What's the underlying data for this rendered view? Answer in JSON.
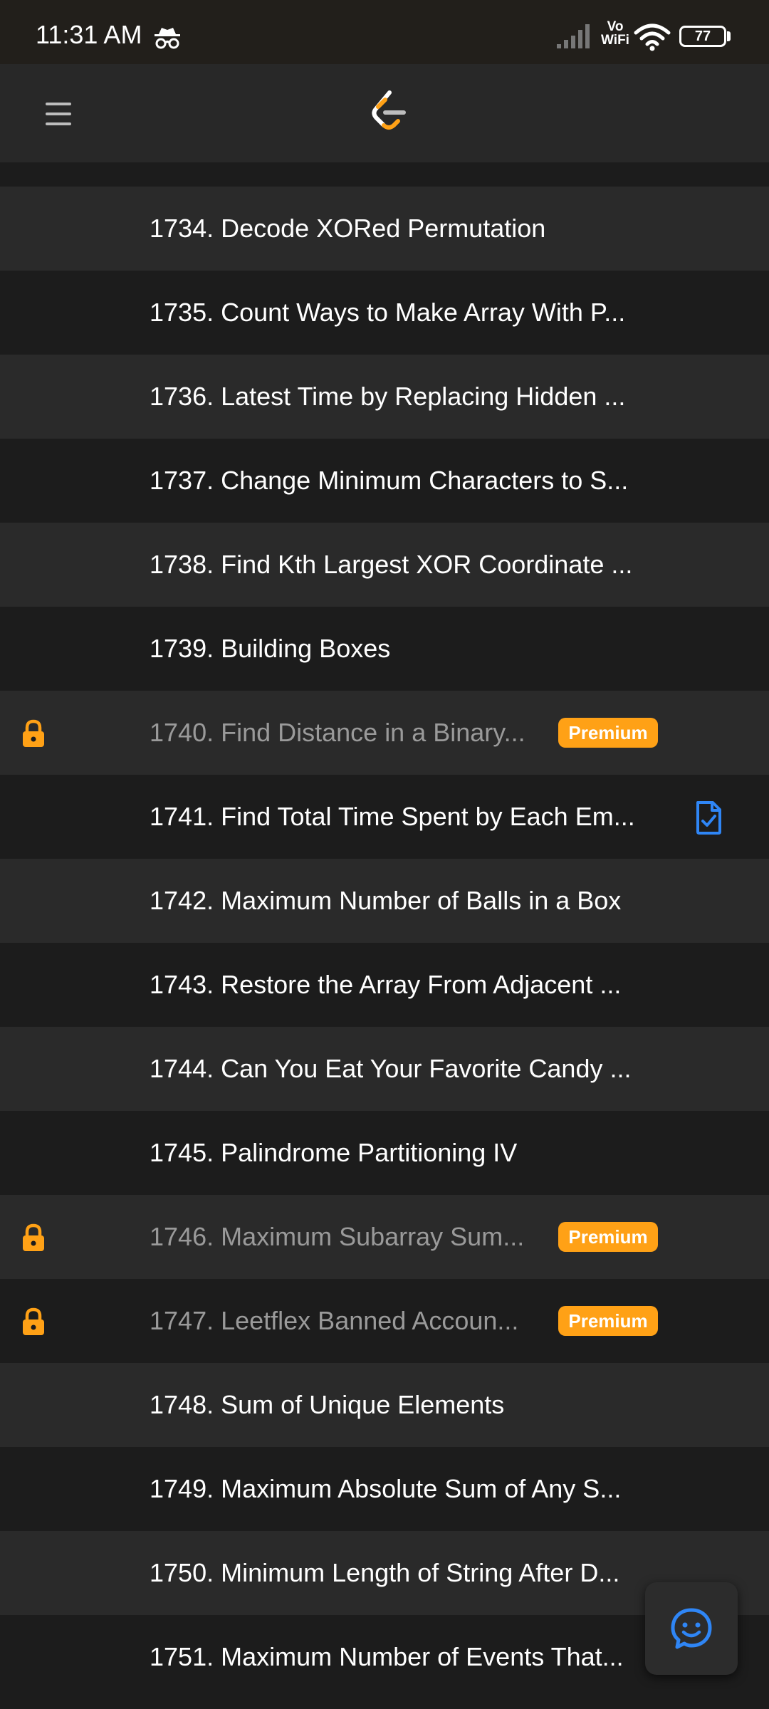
{
  "status_bar": {
    "time": "11:31 AM",
    "vowifi_line1": "Vo",
    "vowifi_line2": "WiFi",
    "battery": "77",
    "icons": [
      "incognito-icon",
      "signal-icon",
      "wifi-icon",
      "battery-icon"
    ]
  },
  "app_bar": {
    "icons": [
      "menu-icon",
      "leetcode-logo-icon"
    ]
  },
  "colors": {
    "premium": "#ffa116",
    "accent_blue": "#2f86f6",
    "row_light": "#2a2a2a",
    "row_dark": "#1c1c1c"
  },
  "problems": [
    {
      "title": "1734. Decode XORed Permutation",
      "locked": false,
      "premium": "",
      "solution": false
    },
    {
      "title": "1735. Count Ways to Make Array With P...",
      "locked": false,
      "premium": "",
      "solution": false
    },
    {
      "title": "1736. Latest Time by Replacing Hidden ...",
      "locked": false,
      "premium": "",
      "solution": false
    },
    {
      "title": "1737. Change Minimum Characters to S...",
      "locked": false,
      "premium": "",
      "solution": false
    },
    {
      "title": "1738. Find Kth Largest XOR Coordinate ...",
      "locked": false,
      "premium": "",
      "solution": false
    },
    {
      "title": "1739. Building Boxes",
      "locked": false,
      "premium": "",
      "solution": false
    },
    {
      "title": "1740. Find Distance in a Binary...",
      "locked": true,
      "premium": "Premium",
      "solution": false
    },
    {
      "title": "1741. Find Total Time Spent by Each Em...",
      "locked": false,
      "premium": "",
      "solution": true
    },
    {
      "title": "1742. Maximum Number of Balls in a Box",
      "locked": false,
      "premium": "",
      "solution": false
    },
    {
      "title": "1743. Restore the Array From Adjacent ...",
      "locked": false,
      "premium": "",
      "solution": false
    },
    {
      "title": "1744. Can You Eat Your Favorite Candy ...",
      "locked": false,
      "premium": "",
      "solution": false
    },
    {
      "title": "1745. Palindrome Partitioning IV",
      "locked": false,
      "premium": "",
      "solution": false
    },
    {
      "title": "1746. Maximum Subarray Sum...",
      "locked": true,
      "premium": "Premium",
      "solution": false
    },
    {
      "title": "1747. Leetflex Banned Accoun...",
      "locked": true,
      "premium": "Premium",
      "solution": false
    },
    {
      "title": "1748. Sum of Unique Elements",
      "locked": false,
      "premium": "",
      "solution": false
    },
    {
      "title": "1749. Maximum Absolute Sum of Any S...",
      "locked": false,
      "premium": "",
      "solution": false
    },
    {
      "title": "1750. Minimum Length of String After D...",
      "locked": false,
      "premium": "",
      "solution": false
    },
    {
      "title": "1751. Maximum Number of Events That...",
      "locked": false,
      "premium": "",
      "solution": false
    }
  ],
  "fab": {
    "icon": "chat-smile-icon"
  }
}
